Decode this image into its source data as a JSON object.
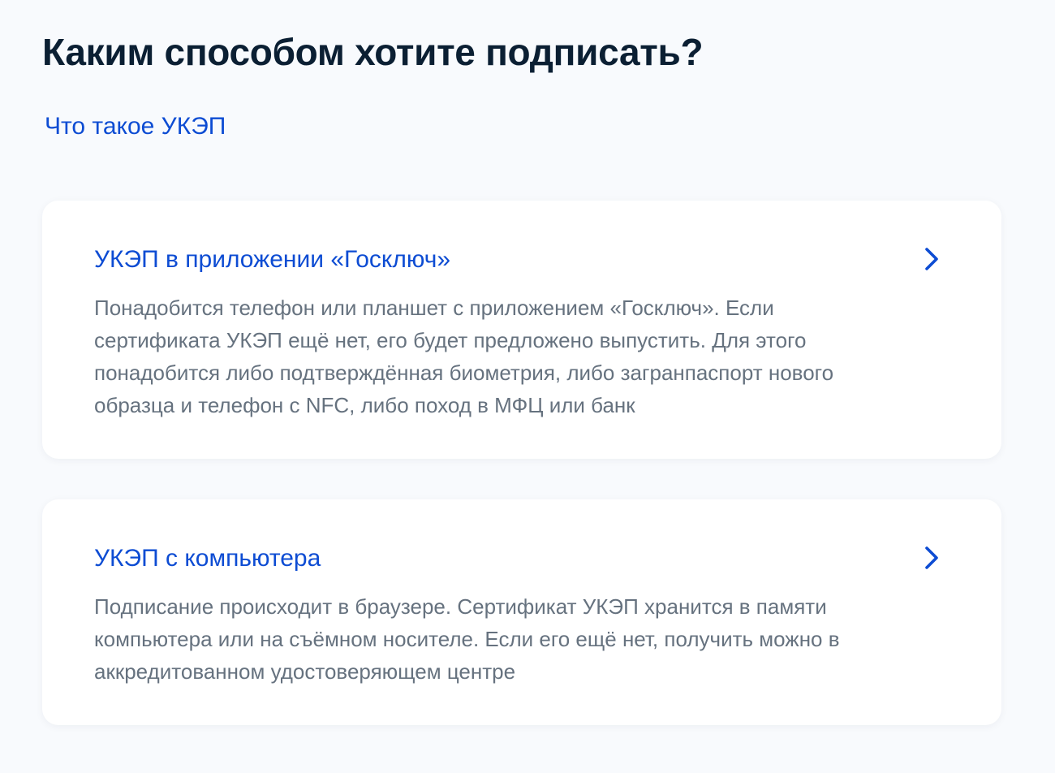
{
  "page": {
    "title": "Каким способом хотите подписать?",
    "ukep_link": "Что такое УКЭП"
  },
  "options": [
    {
      "title": "УКЭП в приложении «Госключ»",
      "description": "Понадобится телефон или планшет с приложением «Госключ». Если сертификата УКЭП ещё нет, его будет предложено выпустить. Для этого понадобится либо подтверждённая биометрия, либо загранпаспорт нового образца и телефон с NFC, либо поход в МФЦ или банк",
      "icon": "chevron-right-icon"
    },
    {
      "title": "УКЭП с компьютера",
      "description": "Подписание происходит в браузере. Сертификат УКЭП хранится в памяти компьютера или на съёмном носителе. Если его ещё нет, получить можно в аккредитованном удостоверяющем центре",
      "icon": "chevron-right-icon"
    }
  ],
  "colors": {
    "background": "#f8fafd",
    "card": "#ffffff",
    "link": "#0d4cd3",
    "title": "#0b1f33",
    "description": "#66727f"
  }
}
